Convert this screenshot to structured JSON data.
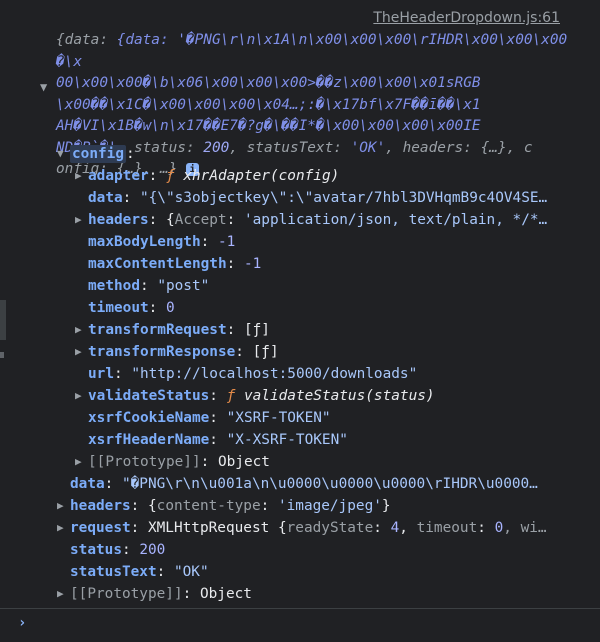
{
  "source_link": "TheHeaderDropdown.js:61",
  "summary": {
    "line1": "{data: '�PNG\\r\\n\\x1A\\n\\x00\\x00\\x00\\rIHDR\\x00\\x00\\x00�\\x",
    "line2": "00\\x00\\x00�\\b\\x06\\x00\\x00\\x00>��z\\x00\\x00\\x01sRGB",
    "line3": "\\x00��\\x1C�\\x00\\x00\\x00\\x04…;:�\\x17bf\\x7F��ī��\\x1",
    "line4": "AH�VI\\x1B�w\\n\\x17��E7�?g�\\��I*�\\x00\\x00\\x00\\x00IE",
    "line5_start": "ND�B`�'",
    "line5_status_key": "status",
    "line5_status_val": "200",
    "line5_statustext_key": "statusText",
    "line5_statustext_val": "'OK'",
    "line5_headers_key": "headers",
    "line5_headers_val": "{…}",
    "line5_c": ", c",
    "line6": "onfig: {…}, …}",
    "info_icon": "i"
  },
  "config": {
    "label": "config",
    "adapter_key": "adapter",
    "adapter_f": "ƒ",
    "adapter_sig": "xhrAdapter(config)",
    "data_key": "data",
    "data_val": "\"{\\\"s3objectkey\\\":\\\"avatar/7hbl3DVHqmB9c4OV4SE…",
    "headers_key": "headers",
    "headers_val_open": "{",
    "headers_accept_key": "Accept",
    "headers_accept_val": "'application/json, text/plain, */*…",
    "maxBodyLength_key": "maxBodyLength",
    "maxBodyLength_val": "-1",
    "maxContentLength_key": "maxContentLength",
    "maxContentLength_val": "-1",
    "method_key": "method",
    "method_val": "\"post\"",
    "timeout_key": "timeout",
    "timeout_val": "0",
    "transformRequest_key": "transformRequest",
    "transformRequest_val": "[ƒ]",
    "transformResponse_key": "transformResponse",
    "transformResponse_val": "[ƒ]",
    "url_key": "url",
    "url_val": "\"http://localhost:5000/downloads\"",
    "validateStatus_key": "validateStatus",
    "validateStatus_f": "ƒ",
    "validateStatus_sig": "validateStatus(status)",
    "xsrfCookieName_key": "xsrfCookieName",
    "xsrfCookieName_val": "\"XSRF-TOKEN\"",
    "xsrfHeaderName_key": "xsrfHeaderName",
    "xsrfHeaderName_val": "\"X-XSRF-TOKEN\"",
    "prototype_key": "[[Prototype]]",
    "prototype_val": "Object"
  },
  "response": {
    "data_key": "data",
    "data_val": "\"�PNG\\r\\n\\u001a\\n\\u0000\\u0000\\u0000\\rIHDR\\u0000…",
    "headers_key": "headers",
    "headers_open": "{",
    "headers_ct_key": "content-type",
    "headers_ct_val": "'image/jpeg'",
    "headers_close": "}",
    "request_key": "request",
    "request_type": "XMLHttpRequest",
    "request_open": "{",
    "request_rs_key": "readyState",
    "request_rs_val": "4",
    "request_to_key": "timeout",
    "request_to_val": "0",
    "request_more": ", wi…",
    "status_key": "status",
    "status_val": "200",
    "statusText_key": "statusText",
    "statusText_val": "\"OK\"",
    "prototype_key": "[[Prototype]]",
    "prototype_val": "Object"
  },
  "console": {
    "prompt": "›"
  }
}
